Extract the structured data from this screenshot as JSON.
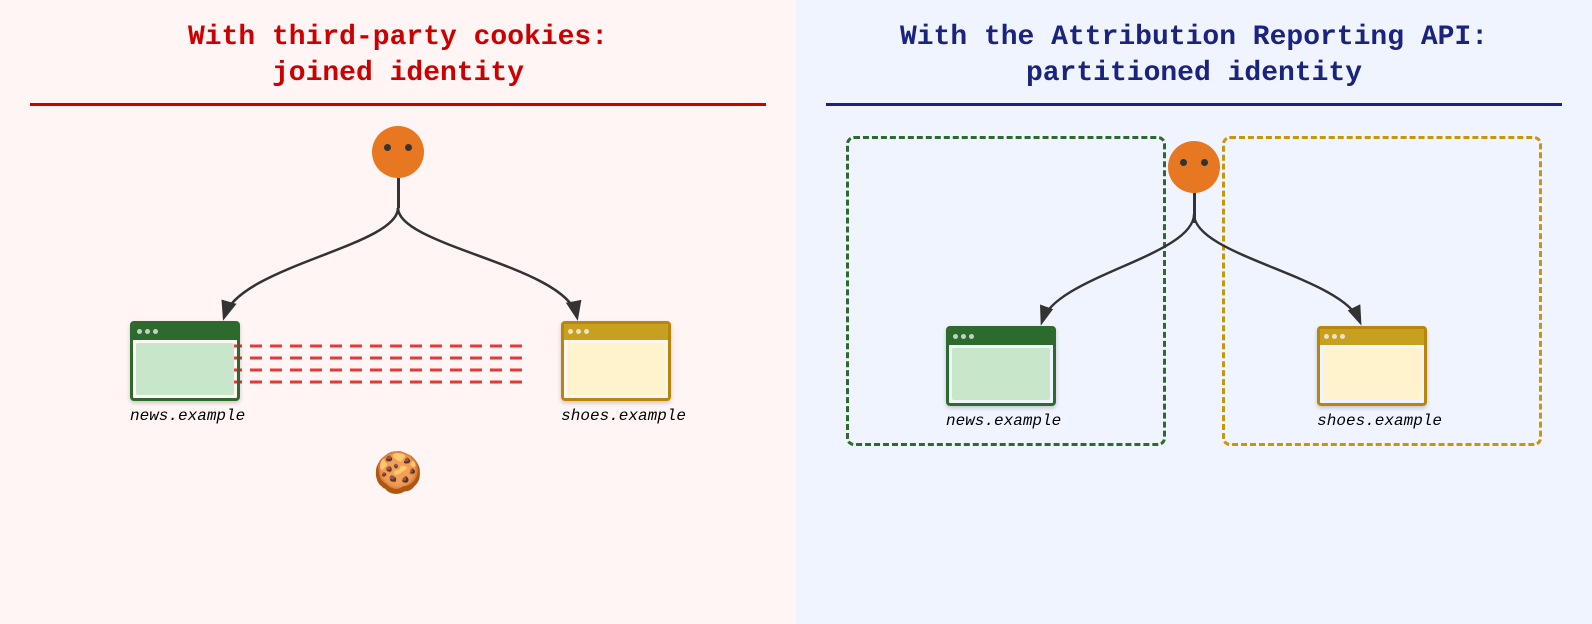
{
  "left_panel": {
    "title_line1": "With third-party cookies:",
    "title_line2": "joined identity",
    "background": "#fff5f5",
    "divider_color": "#cc0000",
    "title_color": "#cc0000",
    "site1_label": "news.example",
    "site2_label": "shoes.example"
  },
  "right_panel": {
    "title_line1": "With the Attribution Reporting API:",
    "title_line2": "partitioned identity",
    "background": "#f0f4ff",
    "divider_color": "#1a237e",
    "title_color": "#1a237e",
    "site1_label": "news.example",
    "site2_label": "shoes.example"
  }
}
